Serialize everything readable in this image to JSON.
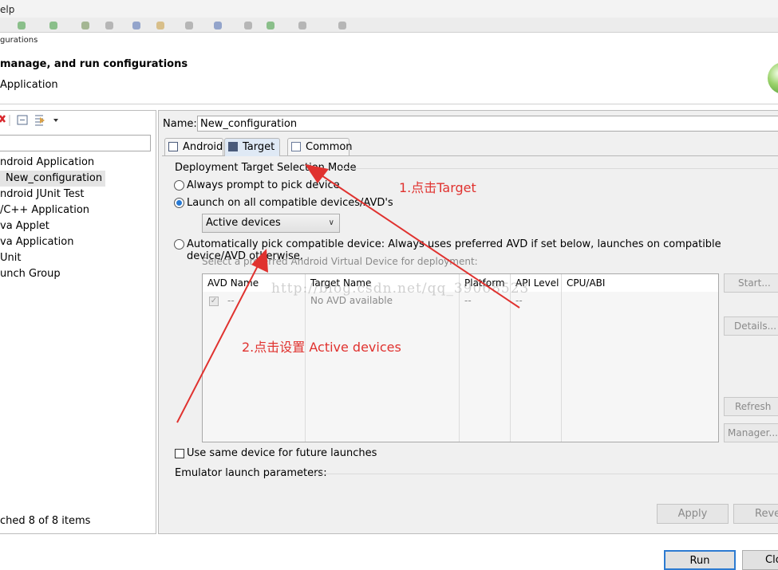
{
  "menubar": {
    "label": "elp"
  },
  "dialog": {
    "title": "gurations",
    "header_title": "manage, and run configurations",
    "header_message": "Application"
  },
  "left": {
    "tree": [
      "ndroid Application",
      "New_configuration",
      "ndroid JUnit Test",
      "/C++ Application",
      "va Applet",
      "va Application",
      "Unit",
      "unch Group"
    ],
    "filter_status": "ched 8 of 8 items"
  },
  "config": {
    "name_label": "Name:",
    "name_value": "New_configuration",
    "tabs": [
      "Android",
      "Target",
      "Common"
    ]
  },
  "target": {
    "group_title": "Deployment Target Selection Mode",
    "opt_prompt": "Always prompt to pick device",
    "opt_launch_all": "Launch on all compatible devices/AVD's",
    "device_select": "Active devices",
    "opt_auto": "Automatically pick compatible device: Always uses preferred AVD if set below, launches on compatible device/AVD otherwise.",
    "avd_hint": "Select a preferred Android Virtual Device for deployment:",
    "avd_columns": [
      "AVD Name",
      "Target Name",
      "Platform",
      "API Level",
      "CPU/ABI"
    ],
    "avd_row": [
      "--",
      "No AVD available",
      "--",
      "--",
      ""
    ],
    "side_buttons": [
      "Start...",
      "Details...",
      "Refresh",
      "Manager..."
    ],
    "same_device": "Use same device for future launches",
    "emulator_params": "Emulator launch parameters:"
  },
  "buttons": {
    "apply": "Apply",
    "revert": "Reve",
    "run": "Run",
    "close": "Clo"
  },
  "watermark": "http://blog.csdn.net/qq_39068523",
  "annotations": {
    "step1": "1.点击Target",
    "step2": "2.点击设置 Active devices"
  },
  "colors": {
    "accent": "#2679d4",
    "annotation": "#e0322f"
  }
}
